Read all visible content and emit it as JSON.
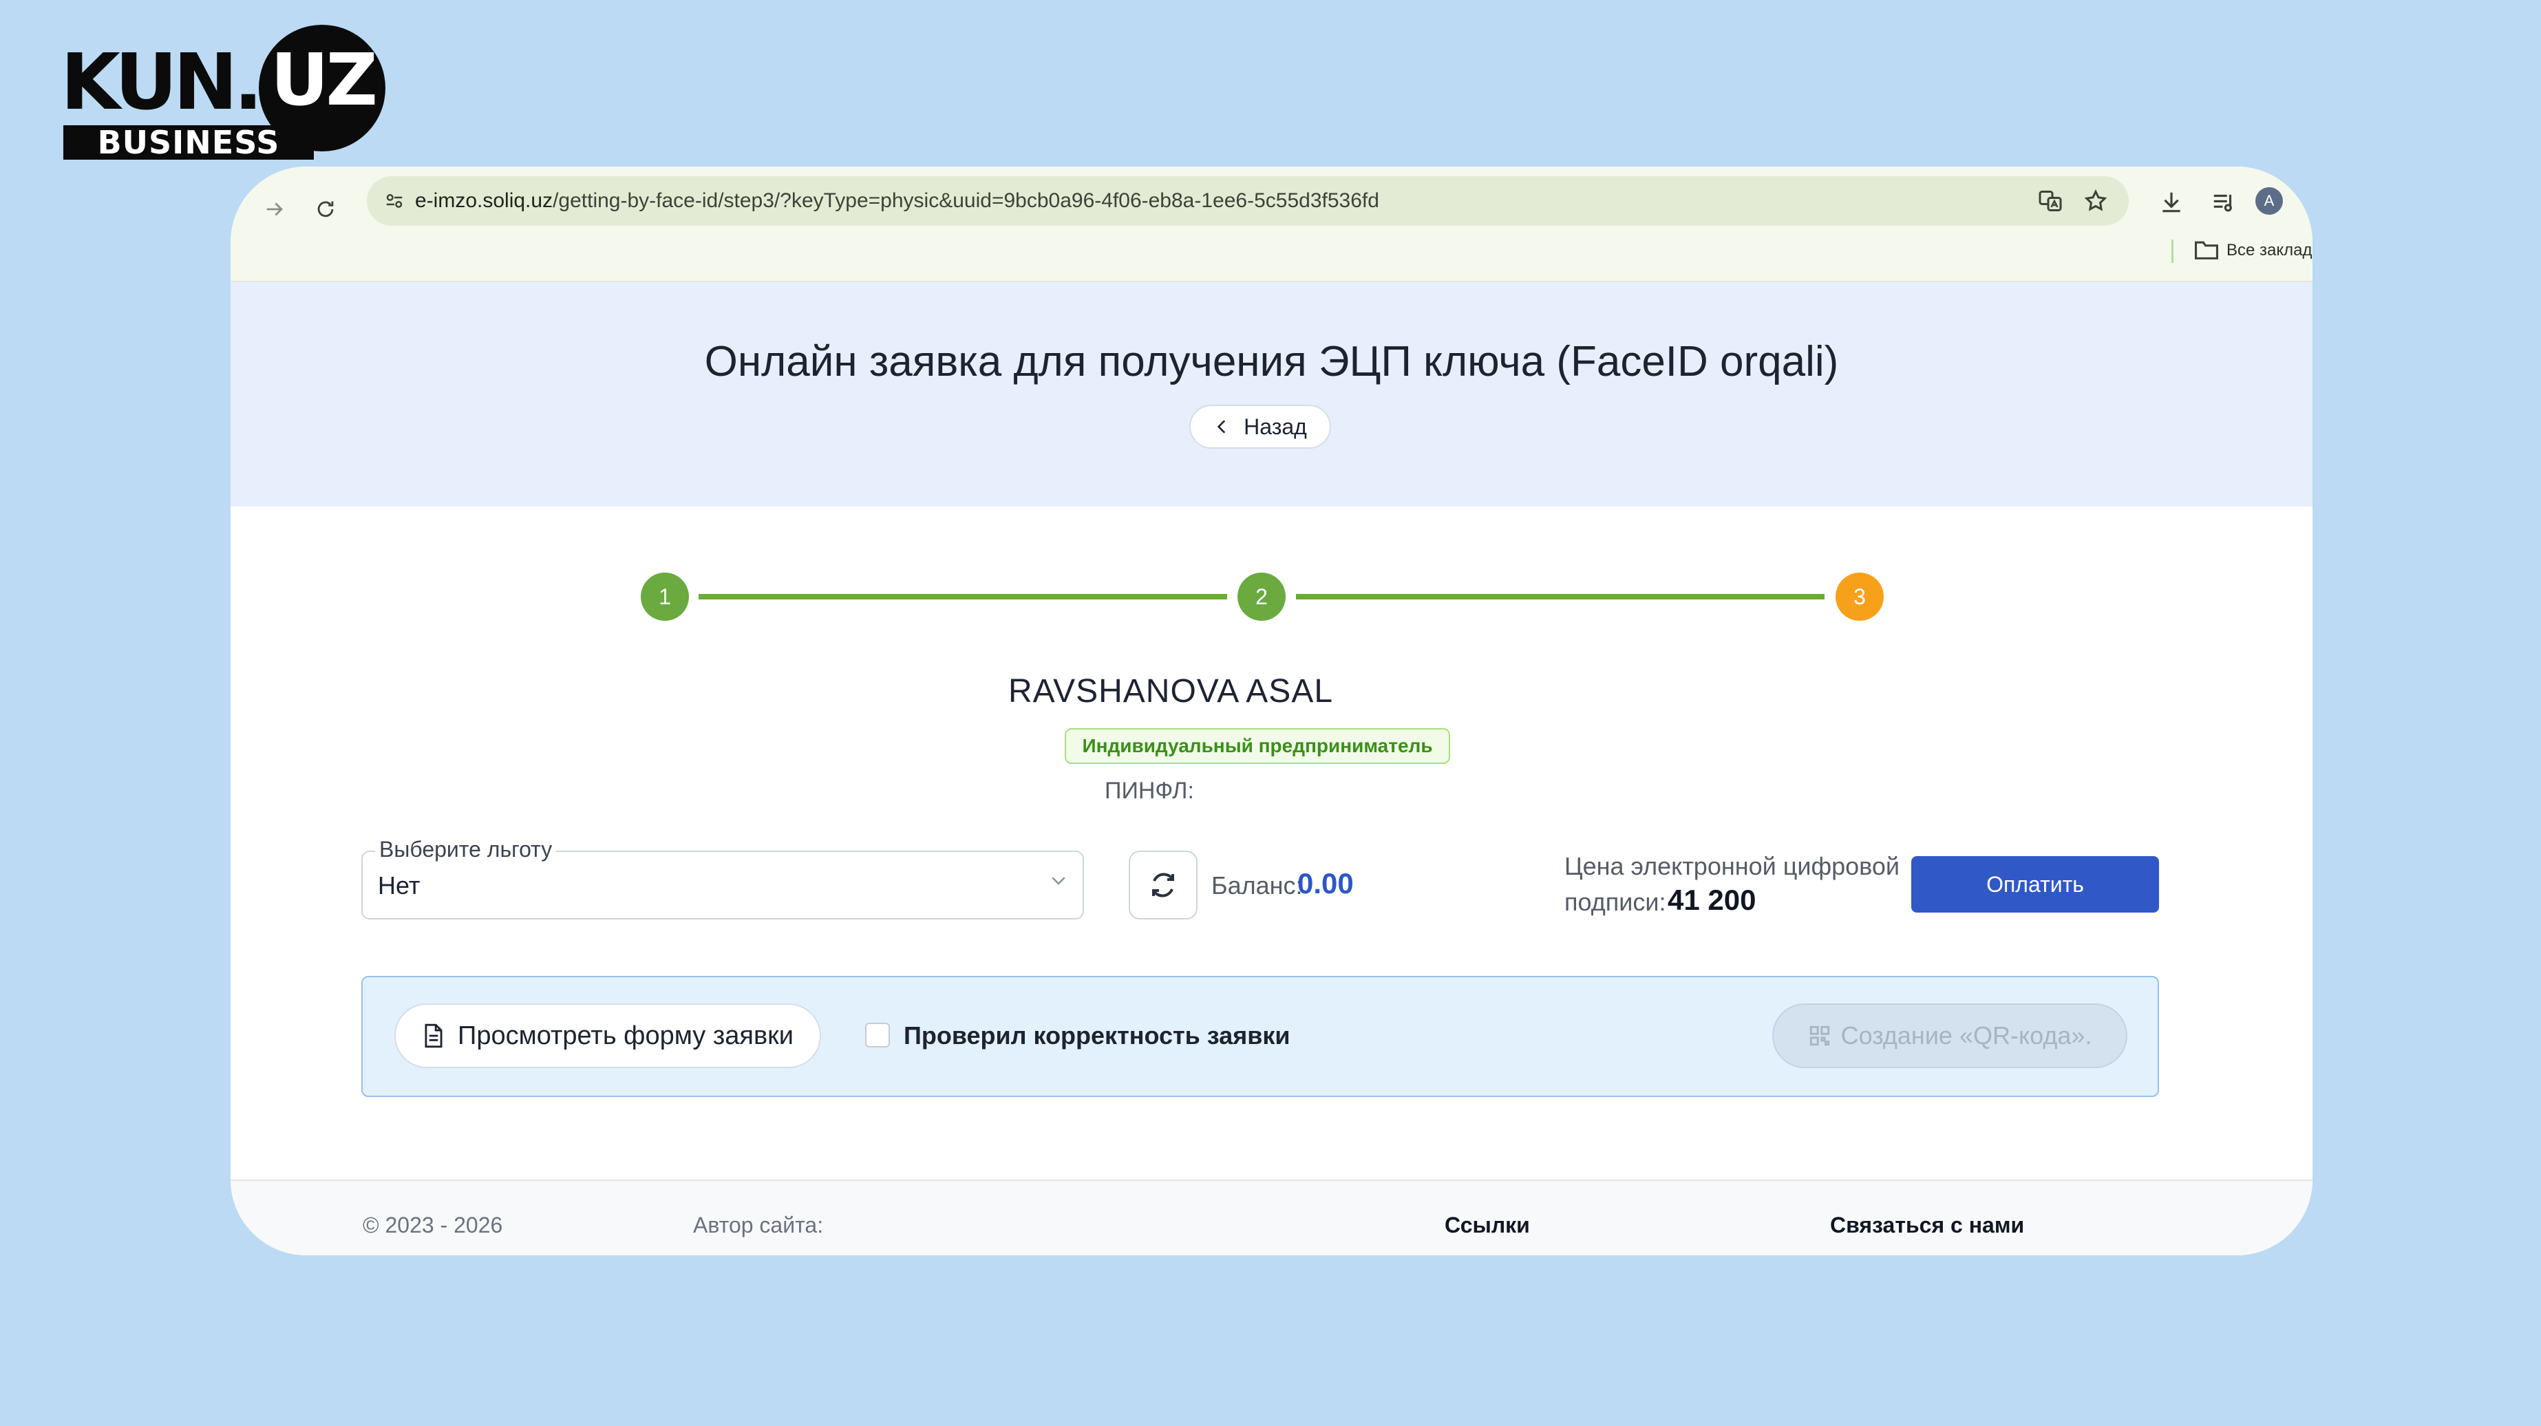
{
  "logo": {
    "main": "KUN.",
    "circle": "UZ",
    "sub": "BUSINESS"
  },
  "browser": {
    "url_domain": "e-imzo.soliq.uz",
    "url_path": "/getting-by-face-id/step3/?keyType=physic&uuid=9bcb0a96-4f06-eb8a-1ee6-5c55d3f536fd",
    "avatar_letter": "A",
    "bookmarks_label": "Все заклад",
    "icons": [
      "forward-icon",
      "reload-icon",
      "site-settings-icon",
      "translate-icon",
      "star-icon",
      "download-icon",
      "reading-list-icon",
      "folder-icon"
    ]
  },
  "header": {
    "title": "Онлайн заявка для получения ЭЦП ключа (FaceID orqali)",
    "back_label": "Назад"
  },
  "stepper": {
    "steps": [
      "1",
      "2",
      "3"
    ],
    "colors": {
      "done": "#6aaa3f",
      "current": "#f7a11a"
    }
  },
  "person": {
    "name": "RAVSHANOVA ASAL",
    "type": "Индивидуальный предприниматель",
    "pinfl_label": "ПИНФЛ:"
  },
  "benefit_select": {
    "label": "Выберите льготу",
    "value": "Нет"
  },
  "balance": {
    "label": "Баланс:",
    "value": "0.00"
  },
  "price": {
    "label_line1": "Цена электронной цифровой",
    "label_line2": "подписи:",
    "value": "41 200"
  },
  "pay_button": "Оплатить",
  "review": {
    "view_form_button": "Просмотреть форму заявки",
    "checkbox_label": "Проверил корректность заявки",
    "qr_button": "Создание «QR-кода»."
  },
  "footer": {
    "copyright": "© 2023 - 2026",
    "author": "Автор сайта:",
    "links": "Ссылки",
    "contact": "Связаться с нами"
  }
}
